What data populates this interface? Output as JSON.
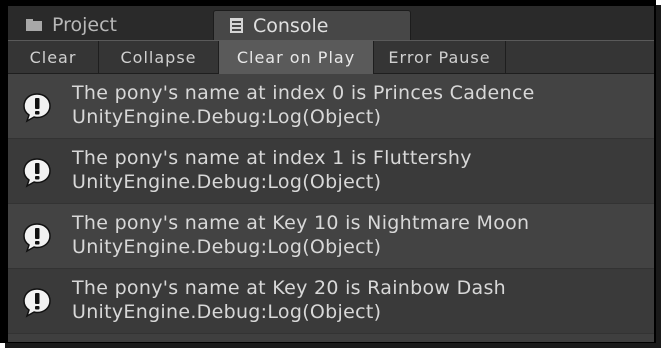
{
  "tabs": [
    {
      "label": "Project",
      "icon": "folder-icon"
    },
    {
      "label": "Console",
      "icon": "console-icon"
    }
  ],
  "toolbar": {
    "clear": "Clear",
    "collapse": "Collapse",
    "clear_on_play": "Clear on Play",
    "error_pause": "Error Pause"
  },
  "entries": [
    {
      "message": "The pony's name at index 0 is Princes Cadence",
      "trace": "UnityEngine.Debug:Log(Object)",
      "icon": "info-bubble-icon"
    },
    {
      "message": "The pony's name at index 1 is Fluttershy",
      "trace": "UnityEngine.Debug:Log(Object)",
      "icon": "info-bubble-icon"
    },
    {
      "message": "The pony's name at Key 10 is Nightmare Moon",
      "trace": "UnityEngine.Debug:Log(Object)",
      "icon": "info-bubble-icon"
    },
    {
      "message": "The pony's name at Key 20 is Rainbow Dash",
      "trace": "UnityEngine.Debug:Log(Object)",
      "icon": "info-bubble-icon"
    }
  ]
}
